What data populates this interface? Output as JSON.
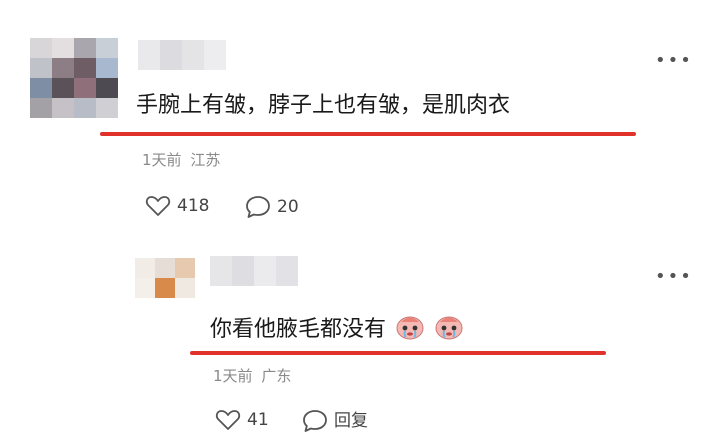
{
  "comments": [
    {
      "text": "手腕上有皱，脖子上也有皱，是肌肉衣",
      "time": "1天前",
      "location": "江苏",
      "likes": "418",
      "replies": "20",
      "more_icon": "more-dots-icon",
      "avatar_colors": [
        "#d8d6d8",
        "#e3dee0",
        "#a9a7ad",
        "#c9cfd6",
        "#bfc3c9",
        "#8d7e86",
        "#6f5d66",
        "#a7b8cf",
        "#7d8ea5",
        "#5a5258",
        "#8f6f7a",
        "#4d4a52",
        "#a3a0a6",
        "#c5c1c6",
        "#b8bcc6",
        "#cfcfd4"
      ],
      "underline_color": "#e0322a"
    },
    {
      "text": "你看他腋毛都没有",
      "time": "1天前",
      "location": "广东",
      "likes": "41",
      "reply_label": "回复",
      "more_icon": "more-dots-icon",
      "emoji_icon": "crying-face-emoji-icon",
      "avatar_colors": [
        "#f2ece6",
        "#e5ddd6",
        "#e6c9ae",
        "#f4efe9",
        "#d88a4a",
        "#f0e9e2"
      ],
      "underline_color": "#e0322a"
    }
  ],
  "icons": {
    "like": "heart-outline-icon",
    "comment": "speech-bubble-icon"
  }
}
